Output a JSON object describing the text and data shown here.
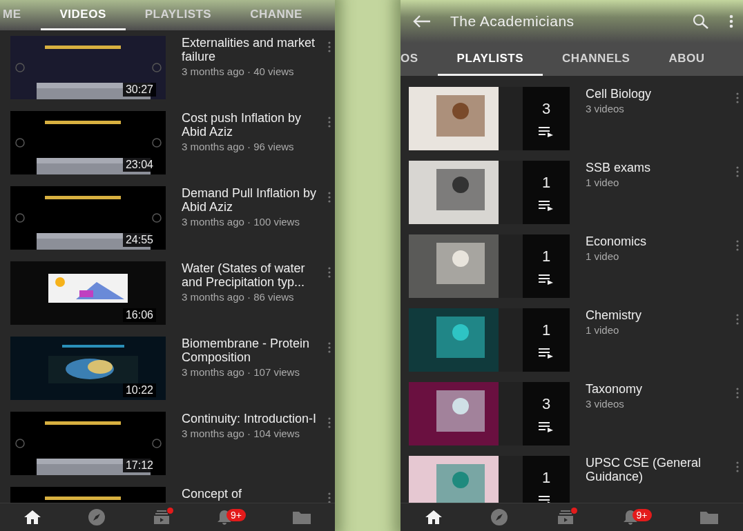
{
  "left_screen": {
    "tabs": [
      {
        "label": "ME",
        "selected": false
      },
      {
        "label": "VIDEOS",
        "selected": true
      },
      {
        "label": "PLAYLISTS",
        "selected": false
      },
      {
        "label": "CHANNE",
        "selected": false
      }
    ],
    "videos": [
      {
        "title": "Externalities and market failure",
        "meta": "3 months ago · 40 views",
        "duration": "30:27"
      },
      {
        "title": "Cost push Inflation by Abid Aziz",
        "meta": "3 months ago · 96 views",
        "duration": "23:04"
      },
      {
        "title": "Demand Pull Inflation by Abid Aziz",
        "meta": "3 months ago · 100 views",
        "duration": "24:55"
      },
      {
        "title": "Water (States of water and Precipitation typ...",
        "meta": "3 months ago · 86 views",
        "duration": "16:06"
      },
      {
        "title": "Biomembrane - Protein Composition",
        "meta": "3 months ago · 107 views",
        "duration": "10:22"
      },
      {
        "title": "Continuity: Introduction-I",
        "meta": "3 months ago · 104 views",
        "duration": "17:12"
      },
      {
        "title": "Concept of"
      }
    ],
    "bottom_nav": [
      {
        "kind": "home",
        "selected": true
      },
      {
        "kind": "explore",
        "selected": false
      },
      {
        "kind": "subscriptions",
        "selected": false,
        "dot": true
      },
      {
        "kind": "notifications",
        "selected": false,
        "badge": "9+"
      },
      {
        "kind": "library",
        "selected": false
      }
    ]
  },
  "right_screen": {
    "title": "The Academicians",
    "tabs": [
      {
        "label": "OS",
        "selected": false
      },
      {
        "label": "PLAYLISTS",
        "selected": true
      },
      {
        "label": "CHANNELS",
        "selected": false
      },
      {
        "label": "ABOU",
        "selected": false
      }
    ],
    "playlists": [
      {
        "title": "Cell Biology",
        "count_label": "3 videos",
        "count": "3"
      },
      {
        "title": "SSB exams",
        "count_label": "1 video",
        "count": "1"
      },
      {
        "title": "Economics",
        "count_label": "1 video",
        "count": "1"
      },
      {
        "title": "Chemistry",
        "count_label": "1 video",
        "count": "1"
      },
      {
        "title": "Taxonomy",
        "count_label": "3 videos",
        "count": "3"
      },
      {
        "title": "UPSC CSE (General Guidance)",
        "count": "1"
      }
    ],
    "bottom_nav": [
      {
        "kind": "home",
        "selected": true
      },
      {
        "kind": "explore",
        "selected": false
      },
      {
        "kind": "subscriptions",
        "selected": false,
        "dot": true
      },
      {
        "kind": "notifications",
        "selected": false,
        "badge": "9+"
      },
      {
        "kind": "library",
        "selected": false
      }
    ]
  }
}
